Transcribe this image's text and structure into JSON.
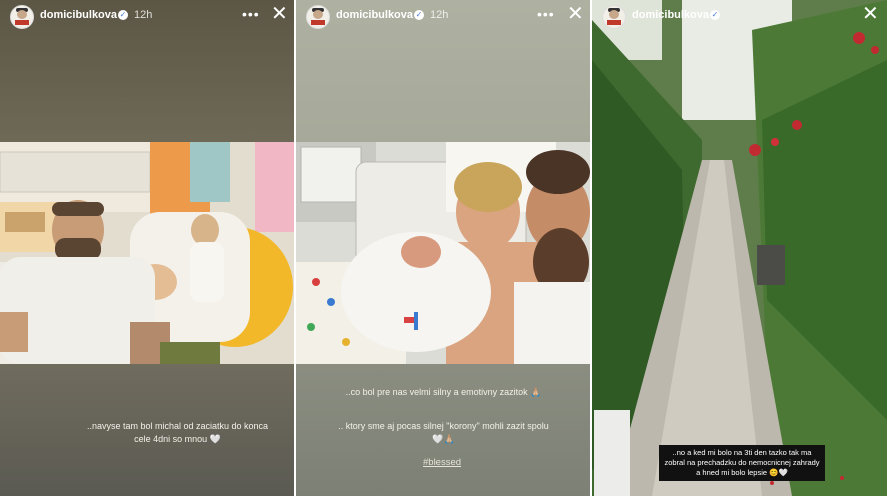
{
  "stories": [
    {
      "username": "domicibulkova",
      "time": "12h",
      "caption": "..navyse tam bol michal od zaciatku do konca cele 4dni so mnou 🤍"
    },
    {
      "username": "domicibulkova",
      "time": "12h",
      "caption_1": "..co bol pre nas velmi silny a emotivny zazitok 🙏🏼",
      "caption_2": ".. ktory sme aj pocas silnej \"korony\" mohli zazit spolu 🤍🙏🏼",
      "hashtag": "#blessed"
    },
    {
      "username": "domicibulkova",
      "caption": "..no a ked mi bolo na 3ti den tazko tak ma zobral na prechadzku do nemocnicnej zahrady a hned mi bolo lepsie 😊🤍"
    }
  ],
  "icons": {
    "verified": "verified-badge-icon",
    "more": "more-options-icon",
    "close": "close-icon"
  },
  "colors": {
    "story1_bg": "#6e6856",
    "story2_bg": "#a6a899",
    "garden_green": "#4f7a3a"
  },
  "glyphs": {
    "verified": "✓",
    "more": "•••",
    "close": "✕"
  }
}
